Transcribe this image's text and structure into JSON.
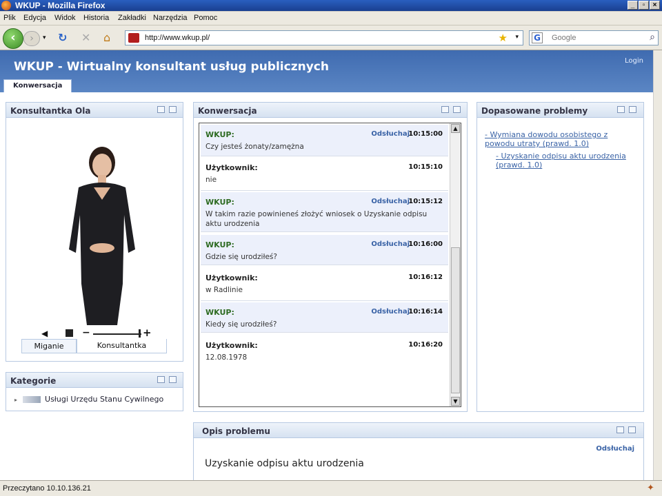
{
  "window": {
    "title": "WKUP - Mozilla Firefox"
  },
  "menu": [
    "Plik",
    "Edycja",
    "Widok",
    "Historia",
    "Zakładki",
    "Narzędzia",
    "Pomoc"
  ],
  "address": {
    "url": "http://www.wkup.pl/"
  },
  "search": {
    "placeholder": "Google"
  },
  "header": {
    "title": "WKUP - Wirtualny konsultant usług publicznych",
    "login": "Login",
    "tab": "Konwersacja"
  },
  "consultant": {
    "title": "Konsultantka Ola",
    "tabs": [
      "Miganie",
      "Konsultantka"
    ]
  },
  "categories": {
    "title": "Kategorie",
    "items": [
      "Usługi Urzędu Stanu Cywilnego"
    ]
  },
  "conversation": {
    "title": "Konwersacja",
    "listen_label": "Odsłuchaj",
    "messages": [
      {
        "who": "WKUP:",
        "text": "Czy jesteś żonaty/zamężna",
        "time": "10:15:00"
      },
      {
        "who": "Użytkownik:",
        "text": "nie",
        "time": "10:15:10"
      },
      {
        "who": "WKUP:",
        "text": "W takim razie powinieneś złożyć wniosek o Uzyskanie odpisu aktu urodzenia",
        "time": "10:15:12"
      },
      {
        "who": "WKUP:",
        "text": "Gdzie się urodziłeś?",
        "time": "10:16:00"
      },
      {
        "who": "Użytkownik:",
        "text": "w Radlinie",
        "time": "10:16:12"
      },
      {
        "who": "WKUP:",
        "text": "Kiedy się urodziłeś?",
        "time": "10:16:14"
      },
      {
        "who": "Użytkownik:",
        "text": "12.08.1978",
        "time": "10:16:20"
      }
    ]
  },
  "matched": {
    "title": "Dopasowane problemy",
    "items": [
      "- Wymiana dowodu osobistego z powodu utraty (prawd. 1.0)",
      "- Uzyskanie odpisu aktu urodzenia (prawd. 1.0)"
    ]
  },
  "problem": {
    "title": "Opis problemu",
    "listen": "Odsłuchaj",
    "heading": "Uzyskanie odpisu aktu urodzenia"
  },
  "status": {
    "text": "Przeczytano 10.10.136.21"
  }
}
